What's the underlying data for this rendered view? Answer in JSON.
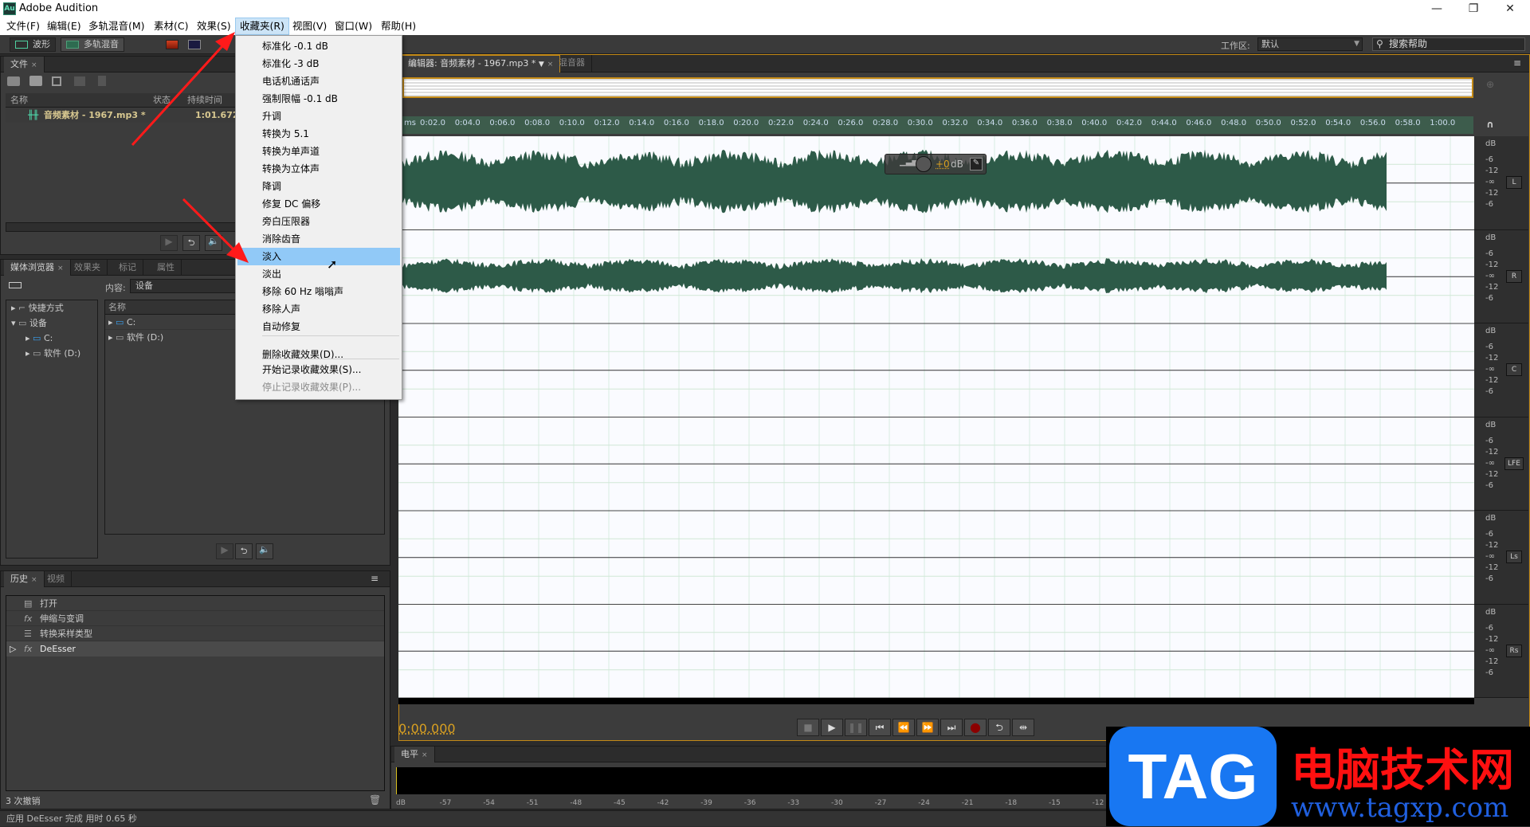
{
  "window": {
    "app_title": "Adobe Audition",
    "logo": "Au",
    "minimize": "—",
    "restore": "❐",
    "close": "✕"
  },
  "menubar": {
    "items": [
      "文件(F)",
      "编辑(E)",
      "多轨混音(M)",
      "素材(C)",
      "效果(S)",
      "收藏夹(R)",
      "视图(V)",
      "窗口(W)",
      "帮助(H)"
    ],
    "active": "收藏夹(R)"
  },
  "toolbar": {
    "waveform_label": "波形",
    "multitrack_label": "多轨混音",
    "workspace_label": "工作区:",
    "workspace_value": "默认",
    "search_placeholder": "搜索帮助"
  },
  "favorites_menu": {
    "items": [
      "标准化 -0.1 dB",
      "标准化 -3 dB",
      "电话机通话声",
      "强制限幅 -0.1 dB",
      "升调",
      "转换为 5.1",
      "转换为单声道",
      "转换为立体声",
      "降调",
      "修复 DC 偏移",
      "旁白压限器",
      "消除齿音",
      "淡入",
      "淡出",
      "移除 60 Hz 嗡嗡声",
      "移除人声",
      "自动修复"
    ],
    "highlighted": "淡入",
    "delete_label": "删除收藏效果(D)...",
    "start_record_label": "开始记录收藏效果(S)...",
    "stop_record_label": "停止记录收藏效果(P)..."
  },
  "files_panel": {
    "tab": "文件",
    "columns": [
      "名称",
      "状态",
      "持续时间"
    ],
    "files": [
      {
        "name": "音频素材 - 1967.mp3 *",
        "status": "",
        "duration": "1:01.672"
      }
    ]
  },
  "media_browser": {
    "tabs": [
      "媒体浏览器",
      "效果夹",
      "标记",
      "属性"
    ],
    "content_label": "内容:",
    "content_value": "设备",
    "tree": [
      {
        "label": "快捷方式",
        "expanded": false
      },
      {
        "label": "设备",
        "expanded": true
      },
      {
        "label": "C:",
        "child": true
      },
      {
        "label": "软件 (D:)",
        "child": true
      }
    ],
    "list_header": "名称",
    "list": [
      "C:",
      "软件 (D:)"
    ]
  },
  "history_panel": {
    "tabs": [
      "历史",
      "视频"
    ],
    "items": [
      {
        "label": "打开",
        "icon": "open-icon"
      },
      {
        "label": "伸缩与变调",
        "icon": "fx-icon"
      },
      {
        "label": "转换采样类型",
        "icon": "convert-icon"
      },
      {
        "label": "DeEsser",
        "icon": "fx-icon",
        "current": true
      }
    ],
    "undo_count": "3 次撤销"
  },
  "editor": {
    "tab_label": "编辑器: 音频素材 - 1967.mp3 *",
    "mixer_tab": "混音器",
    "ruler_unit": "ms",
    "ruler_ticks": [
      "0:02.0",
      "0:04.0",
      "0:06.0",
      "0:08.0",
      "0:10.0",
      "0:12.0",
      "0:14.0",
      "0:16.0",
      "0:18.0",
      "0:20.0",
      "0:22.0",
      "0:24.0",
      "0:26.0",
      "0:28.0",
      "0:30.0",
      "0:32.0",
      "0:34.0",
      "0:36.0",
      "0:38.0",
      "0:40.0",
      "0:42.0",
      "0:44.0",
      "0:46.0",
      "0:48.0",
      "0:50.0",
      "0:52.0",
      "0:54.0",
      "0:56.0",
      "0:58.0",
      "1:00.0"
    ],
    "hud_gain": "+0",
    "hud_unit": "dB",
    "channels": [
      "L",
      "R",
      "C",
      "LFE",
      "Ls",
      "Rs"
    ],
    "db_labels": [
      "dB",
      "-6",
      "-12",
      "-∞",
      "-12",
      "-6"
    ],
    "current_time": "0:00.000"
  },
  "transport": {
    "buttons": [
      "stop",
      "play",
      "pause",
      "go-to-start",
      "rewind",
      "fast-forward",
      "go-to-end",
      "record",
      "loop",
      "skip-selection"
    ]
  },
  "level_meter": {
    "tab": "电平",
    "ticks": [
      "dB",
      "-57",
      "-54",
      "-51",
      "-48",
      "-45",
      "-42",
      "-39",
      "-36",
      "-33",
      "-30",
      "-27",
      "-24",
      "-21",
      "-18",
      "-15",
      "-12"
    ]
  },
  "status_bar": {
    "text": "应用 DeEsser 完成 用时 0.65 秒"
  },
  "watermark": {
    "logo": "TAG",
    "title": "电脑技术网",
    "url": "www.tagxp.com"
  },
  "colors": {
    "accent": "#c48a16",
    "waveform": "#2d5a48",
    "ruler": "#3d5c4c",
    "menu_highlight": "#91c9f7",
    "time_text": "#d9a021",
    "record": "#8b0000"
  }
}
